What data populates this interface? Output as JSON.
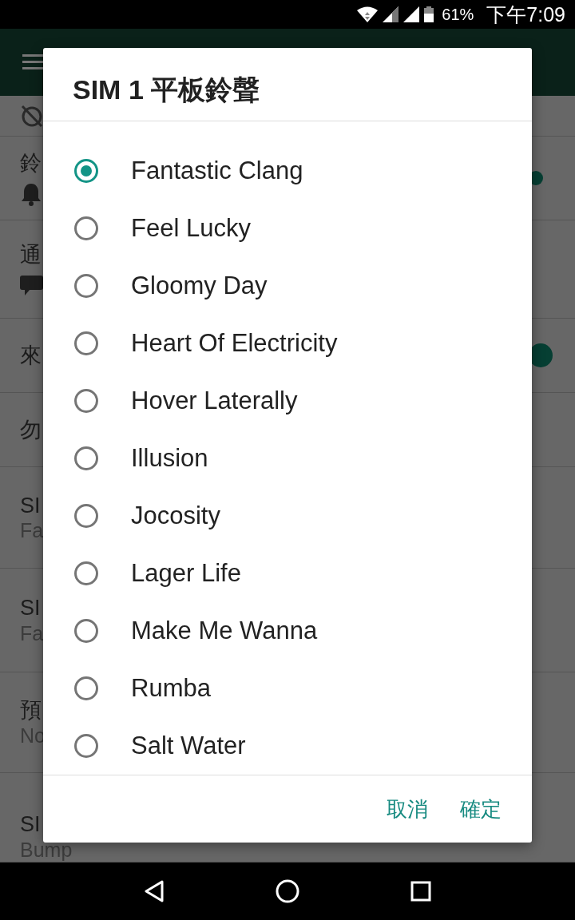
{
  "status_bar": {
    "battery": "61%",
    "time": "下午7:09"
  },
  "settings": [
    {
      "kind": "alarm-off"
    },
    {
      "kind": "bell-slider",
      "title": "鈴"
    },
    {
      "kind": "chat-slider",
      "title": "通"
    },
    {
      "kind": "toggle",
      "title": "來",
      "on": true
    },
    {
      "kind": "plain",
      "title": "勿"
    },
    {
      "kind": "subtitle",
      "title": "SI",
      "subtitle": "Fa"
    },
    {
      "kind": "subtitle",
      "title": "SI",
      "subtitle": "Fa"
    },
    {
      "kind": "subtitle",
      "title": "預",
      "subtitle": "No"
    },
    {
      "kind": "subtitle",
      "title": "SI",
      "subtitle": "Bump"
    }
  ],
  "dialog": {
    "title": "SIM 1 平板鈴聲",
    "options": [
      {
        "label": "Fantastic Clang",
        "selected": true
      },
      {
        "label": "Feel Lucky",
        "selected": false
      },
      {
        "label": "Gloomy Day",
        "selected": false
      },
      {
        "label": "Heart Of Electricity",
        "selected": false
      },
      {
        "label": "Hover Laterally",
        "selected": false
      },
      {
        "label": "Illusion",
        "selected": false
      },
      {
        "label": "Jocosity",
        "selected": false
      },
      {
        "label": "Lager Life",
        "selected": false
      },
      {
        "label": "Make Me Wanna",
        "selected": false
      },
      {
        "label": "Rumba",
        "selected": false
      },
      {
        "label": "Salt Water",
        "selected": false
      }
    ],
    "buttons": [
      "取消",
      "確定"
    ]
  }
}
